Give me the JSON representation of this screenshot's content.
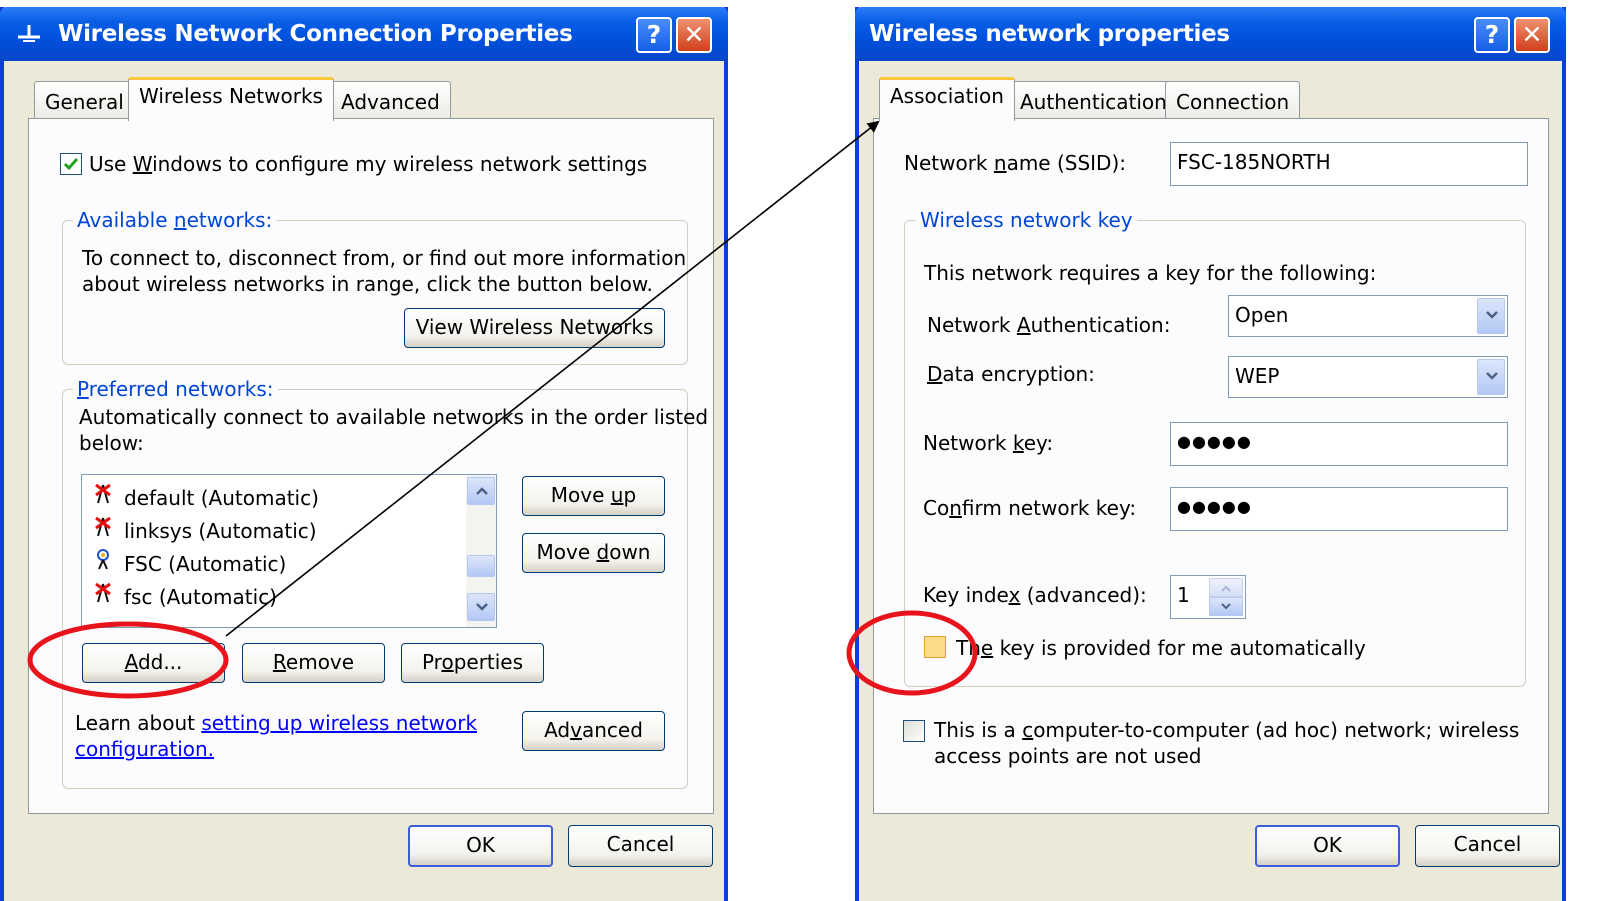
{
  "left_dialog": {
    "title": "Wireless Network Connection Properties",
    "tabs": [
      "General",
      "Wireless Networks",
      "Advanced"
    ],
    "use_windows_label_pre": "Use ",
    "use_windows_label_u": "W",
    "use_windows_label_post": "indows to configure my wireless network settings",
    "use_windows_checked": true,
    "available": {
      "label_pre": "Available ",
      "label_u": "n",
      "label_post": "etworks:",
      "line1": "To connect to, disconnect from, or find out more information",
      "line2": "about wireless networks in range, click the button below.",
      "view_button": "View Wireless Networks"
    },
    "preferred": {
      "label_u": "P",
      "label_post": "referred networks:",
      "line1": "Automatically connect to available networks in the order listed",
      "line2": "below:",
      "networks": [
        {
          "name": "default (Automatic)",
          "icon": "antenna-red-x-icon"
        },
        {
          "name": "linksys (Automatic)",
          "icon": "antenna-red-x-icon"
        },
        {
          "name": "FSC (Automatic)",
          "icon": "antenna-blue-icon"
        },
        {
          "name": "fsc (Automatic)",
          "icon": "antenna-red-x-icon"
        }
      ],
      "move_up_pre": "Move ",
      "move_up_u": "u",
      "move_up_post": "p",
      "move_down_pre": "Move ",
      "move_down_u": "d",
      "move_down_post": "own",
      "add_u": "A",
      "add_post": "dd...",
      "remove_u": "R",
      "remove_post": "emove",
      "properties_pre": "Pr",
      "properties_u": "o",
      "properties_post": "perties",
      "learn_pre": "Learn about ",
      "learn_link1": "setting up wireless network",
      "learn_link2": "configuration.",
      "advanced_pre": "Ad",
      "advanced_u": "v",
      "advanced_post": "anced"
    },
    "ok": "OK",
    "cancel": "Cancel"
  },
  "right_dialog": {
    "title": "Wireless network properties",
    "tabs": [
      "Association",
      "Authentication",
      "Connection"
    ],
    "ssid_label_pre": "Network ",
    "ssid_label_u": "n",
    "ssid_label_post": "ame (SSID):",
    "ssid_value": "FSC-185NORTH",
    "key_group_label": "Wireless network key",
    "key_intro": "This network requires a key for the following:",
    "auth_label_pre": "Network ",
    "auth_label_u": "A",
    "auth_label_post": "uthentication:",
    "auth_value": "Open",
    "enc_label_u": "D",
    "enc_label_post": "ata encryption:",
    "enc_value": "WEP",
    "netkey_label_pre": "Network ",
    "netkey_label_u": "k",
    "netkey_label_post": "ey:",
    "netkey_value": "●●●●●",
    "confirm_label_pre": "Co",
    "confirm_label_u": "n",
    "confirm_label_post": "firm network key:",
    "confirm_value": "●●●●●",
    "keyindex_label_pre": "Key inde",
    "keyindex_label_u": "x",
    "keyindex_label_post": " (advanced):",
    "keyindex_value": "1",
    "auto_key_label_pre": "Th",
    "auto_key_label_u": "e",
    "auto_key_label_post": " key is provided for me automatically",
    "adhoc_line1_pre": "This is a ",
    "adhoc_line1_u": "c",
    "adhoc_line1_post": "omputer-to-computer (ad hoc) network; wireless",
    "adhoc_line2": "access points are not used",
    "ok": "OK",
    "cancel": "Cancel"
  },
  "annotation_color": "#e8141c"
}
